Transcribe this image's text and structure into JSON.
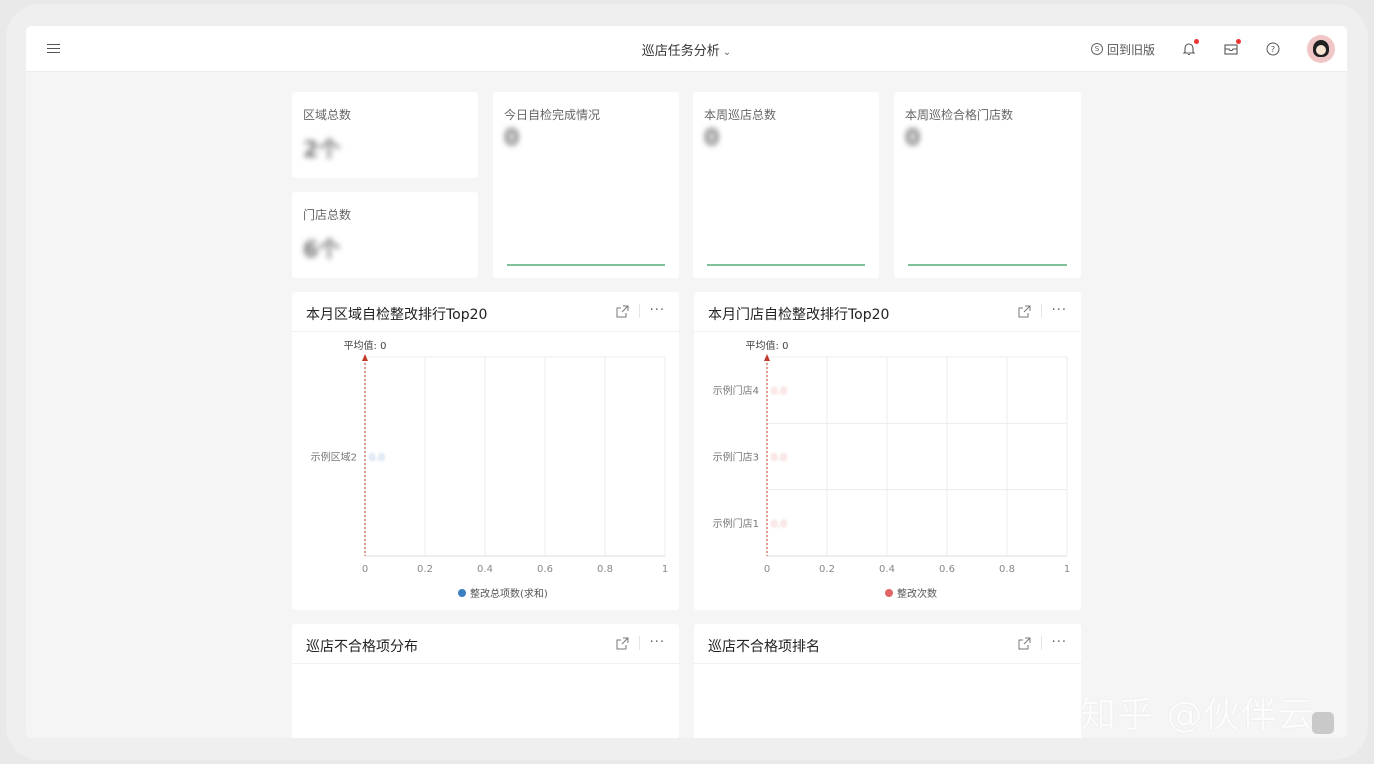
{
  "header": {
    "title": "巡店任务分析",
    "back_old": "回到旧版"
  },
  "kpis": {
    "region_total": {
      "label": "区域总数",
      "value": "2个"
    },
    "store_total": {
      "label": "门店总数",
      "value": "6个"
    },
    "today_selfcheck": {
      "label": "今日自检完成情况",
      "value": "0"
    },
    "week_patrol_total": {
      "label": "本周巡店总数",
      "value": "0"
    },
    "week_pass_stores": {
      "label": "本周巡检合格门店数",
      "value": "0"
    }
  },
  "panels": {
    "region_rank": {
      "title": "本月区域自检整改排行Top20"
    },
    "store_rank": {
      "title": "本月门店自检整改排行Top20"
    },
    "fail_dist": {
      "title": "巡店不合格项分布"
    },
    "fail_rank": {
      "title": "巡店不合格项排名"
    }
  },
  "chart_data": [
    {
      "type": "bar",
      "orientation": "horizontal",
      "title": "本月区域自检整改排行Top20",
      "categories": [
        "示例区域2"
      ],
      "series": [
        {
          "name": "整改总项数(求和)",
          "values": [
            0
          ],
          "color": "#3a7fc1"
        }
      ],
      "data_labels": [
        "0.0"
      ],
      "xlim": [
        0,
        1
      ],
      "xticks": [
        "0",
        "0.2",
        "0.4",
        "0.6",
        "0.8",
        "1"
      ],
      "average_label": "平均值: 0",
      "average_value": 0,
      "legend": "bottom",
      "grid": true
    },
    {
      "type": "bar",
      "orientation": "horizontal",
      "title": "本月门店自检整改排行Top20",
      "categories": [
        "示例门店4",
        "示例门店3",
        "示例门店1"
      ],
      "series": [
        {
          "name": "整改次数",
          "values": [
            0,
            0,
            0
          ],
          "color": "#e06666"
        }
      ],
      "data_labels": [
        "0.0",
        "0.0",
        "0.0"
      ],
      "xlim": [
        0,
        1
      ],
      "xticks": [
        "0",
        "0.2",
        "0.4",
        "0.6",
        "0.8",
        "1"
      ],
      "average_label": "平均值: 0",
      "average_value": 0,
      "legend": "bottom",
      "grid": true
    }
  ],
  "watermark": "知乎 @伙伴云"
}
